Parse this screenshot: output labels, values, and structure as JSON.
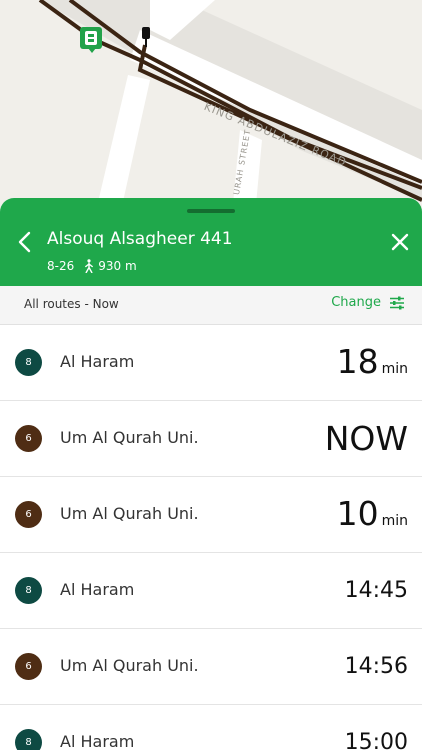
{
  "map": {
    "road_king": "KING ABDULAZIZ ROAD",
    "road_qurah": "URAH STREET"
  },
  "stop": {
    "name": "Alsouq Alsagheer 441",
    "routes": "8-26",
    "distance": "930 m"
  },
  "filter": {
    "label": "All routes - Now",
    "change_label": "Change"
  },
  "colors": {
    "header_green": "#1fa84b",
    "route_8": "#0e4a43",
    "route_6": "#4f2d14",
    "route_line": "#3b2413"
  },
  "departures": [
    {
      "route": "8",
      "destination": "Al Haram",
      "time": "18",
      "unit": "min",
      "kind": "min",
      "color": "#0e4a43"
    },
    {
      "route": "6",
      "destination": "Um Al Qurah Uni.",
      "time": "NOW",
      "unit": "",
      "kind": "now",
      "color": "#4f2d14"
    },
    {
      "route": "6",
      "destination": "Um Al Qurah Uni.",
      "time": "10",
      "unit": "min",
      "kind": "min",
      "color": "#4f2d14"
    },
    {
      "route": "8",
      "destination": "Al Haram",
      "time": "14:45",
      "unit": "",
      "kind": "clock",
      "color": "#0e4a43"
    },
    {
      "route": "6",
      "destination": "Um Al Qurah Uni.",
      "time": "14:56",
      "unit": "",
      "kind": "clock",
      "color": "#4f2d14"
    },
    {
      "route": "8",
      "destination": "Al Haram",
      "time": "15:00",
      "unit": "",
      "kind": "clock",
      "color": "#0e4a43"
    }
  ]
}
